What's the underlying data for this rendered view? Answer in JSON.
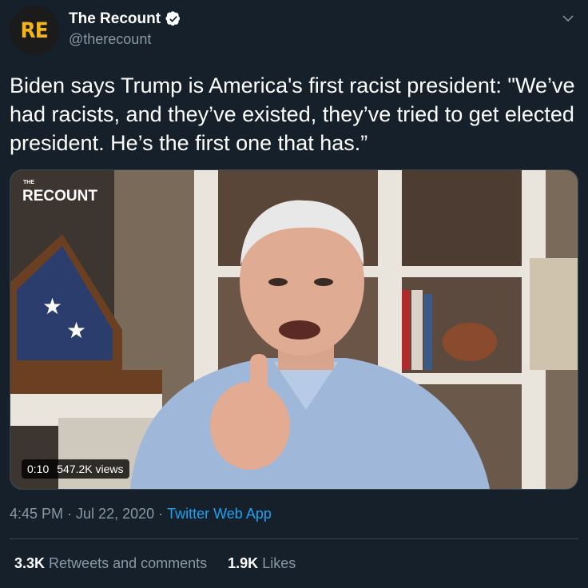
{
  "author": {
    "display_name": "The Recount",
    "handle": "@therecount",
    "avatar_text": "RE",
    "verified": true
  },
  "tweet": {
    "text": "Biden says Trump is America's first racist president: \"We’ve had racists, and they’ve existed, they’ve tried to get elected president. He’s the first one that has.”"
  },
  "media": {
    "watermark_small": "THE",
    "watermark_large": "RECOUNT",
    "duration": "0:10",
    "views": "547.2K views"
  },
  "meta": {
    "time": "4:45 PM",
    "separator": "·",
    "date": "Jul 22, 2020",
    "source": "Twitter Web App"
  },
  "stats": {
    "retweets_count": "3.3K",
    "retweets_label": "Retweets and comments",
    "likes_count": "1.9K",
    "likes_label": "Likes"
  },
  "colors": {
    "background": "#15202b",
    "secondary_text": "#8899a6",
    "link": "#1da1f2",
    "avatar_letters": "#f2b418",
    "verified_badge": "#ffffff"
  },
  "icons": [
    "verified-badge-icon",
    "chevron-down-icon"
  ]
}
